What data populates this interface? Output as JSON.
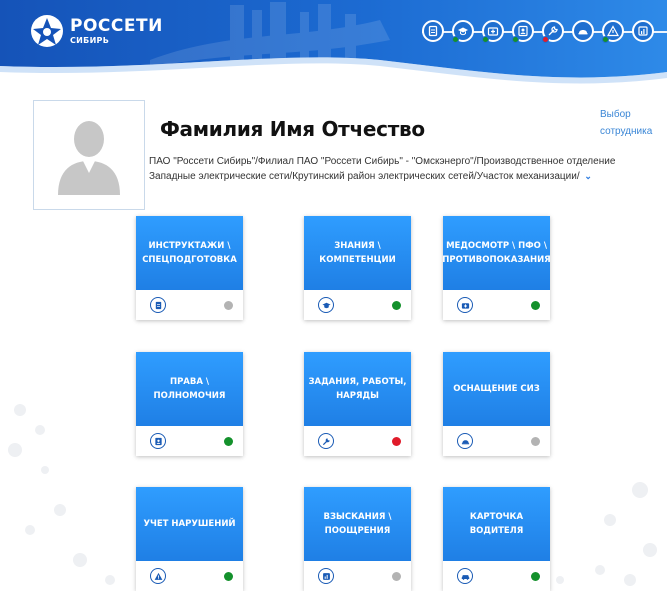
{
  "brand": {
    "name": "РОССЕТИ",
    "sub": "СИБИРЬ"
  },
  "colors": {
    "green": "#14912c",
    "red": "#e01b2a",
    "gray": "#b3b3b3",
    "blue": "#1f7fe5"
  },
  "nav": [
    {
      "icon": "clipboard-icon",
      "status": "none"
    },
    {
      "icon": "graduation-cap-icon",
      "status": "green"
    },
    {
      "icon": "medical-kit-icon",
      "status": "green"
    },
    {
      "icon": "id-badge-icon",
      "status": "green"
    },
    {
      "icon": "wrench-icon",
      "status": "red"
    },
    {
      "icon": "helmet-icon",
      "status": "none"
    },
    {
      "icon": "warning-icon",
      "status": "green"
    },
    {
      "icon": "chart-icon",
      "status": "none"
    }
  ],
  "profile": {
    "name": "Фамилия Имя Отчество",
    "select_label": "Выбор сотрудника",
    "org_path": "ПАО \"Россети Сибирь\"/Филиал ПАО \"Россети Сибирь\" - \"Омскэнерго\"/Производственное отделение Западные электрические сети/Крутинский район электрических сетей/Участок механизации/",
    "chevron": "⌄"
  },
  "cards": [
    {
      "title": "ИНСТРУКТАЖИ \\ СПЕЦПОДГОТОВКА",
      "icon": "clipboard-icon",
      "status": "gray"
    },
    {
      "title": "ЗНАНИЯ \\ КОМПЕТЕНЦИИ",
      "icon": "graduation-cap-icon",
      "status": "green"
    },
    {
      "title": "МЕДОСМОТР \\ ПФО \\ ПРОТИВОПОКАЗАНИЯ",
      "icon": "medical-kit-icon",
      "status": "green"
    },
    {
      "title": "ПРАВА \\ ПОЛНОМОЧИЯ",
      "icon": "id-badge-icon",
      "status": "green"
    },
    {
      "title": "ЗАДАНИЯ, РАБОТЫ, НАРЯДЫ",
      "icon": "wrench-icon",
      "status": "red"
    },
    {
      "title": "ОСНАЩЕНИЕ СИЗ",
      "icon": "helmet-icon",
      "status": "gray"
    },
    {
      "title": "УЧЕТ НАРУШЕНИЙ",
      "icon": "warning-icon",
      "status": "green"
    },
    {
      "title": "ВЗЫСКАНИЯ \\ ПООЩРЕНИЯ",
      "icon": "chart-icon",
      "status": "gray"
    },
    {
      "title": "КАРТОЧКА ВОДИТЕЛЯ",
      "icon": "car-icon",
      "status": "green"
    }
  ]
}
